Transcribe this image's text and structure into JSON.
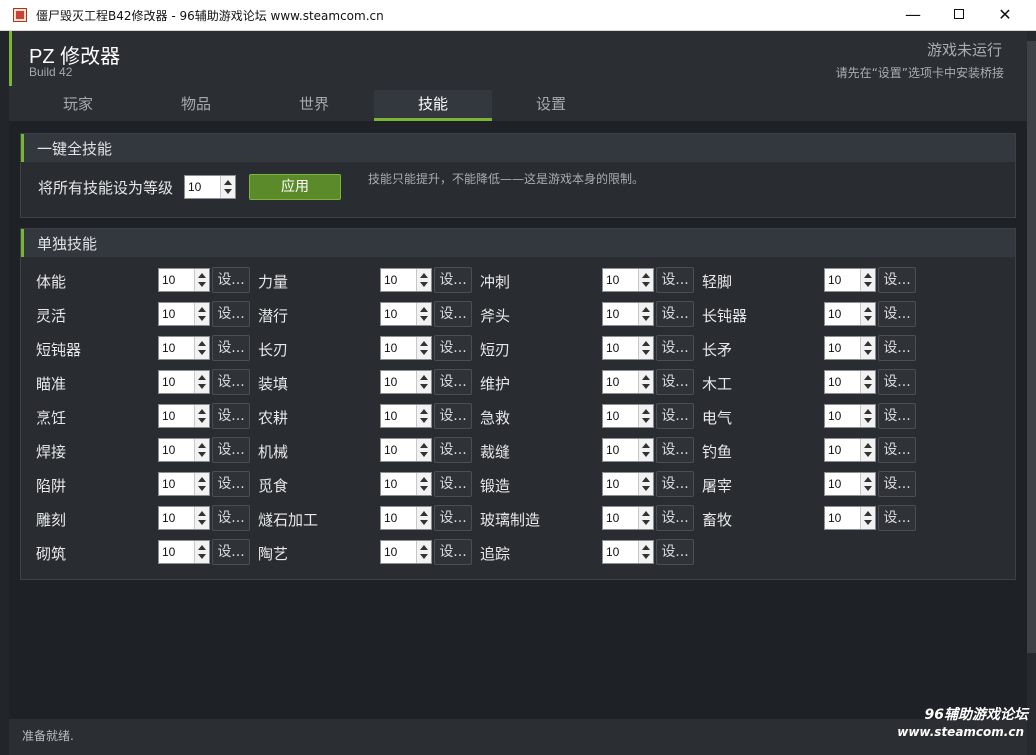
{
  "window": {
    "title": "僵尸毁灭工程B42修改器 - 96辅助游戏论坛 www.steamcom.cn",
    "minimize": "—",
    "close": "✕"
  },
  "header": {
    "app_title": "PZ 修改器",
    "build": "Build 42",
    "status_main": "游戏未运行",
    "status_sub": "请先在“设置”选项卡中安装桥接"
  },
  "tabs": [
    {
      "label": "玩家"
    },
    {
      "label": "物品"
    },
    {
      "label": "世界"
    },
    {
      "label": "技能"
    },
    {
      "label": "设置"
    }
  ],
  "active_tab": "技能",
  "all_skills": {
    "title": "一键全技能",
    "label": "将所有技能设为等级",
    "value": "10",
    "apply_label": "应用",
    "hint": "技能只能提升，不能降低——这是游戏本身的限制。"
  },
  "single_skills": {
    "title": "单独技能",
    "set_label": "设...",
    "items": [
      {
        "label": "体能",
        "value": "10"
      },
      {
        "label": "力量",
        "value": "10"
      },
      {
        "label": "冲刺",
        "value": "10"
      },
      {
        "label": "轻脚",
        "value": "10"
      },
      {
        "label": "灵活",
        "value": "10"
      },
      {
        "label": "潜行",
        "value": "10"
      },
      {
        "label": "斧头",
        "value": "10"
      },
      {
        "label": "长钝器",
        "value": "10"
      },
      {
        "label": "短钝器",
        "value": "10"
      },
      {
        "label": "长刃",
        "value": "10"
      },
      {
        "label": "短刃",
        "value": "10"
      },
      {
        "label": "长矛",
        "value": "10"
      },
      {
        "label": "瞄准",
        "value": "10"
      },
      {
        "label": "装填",
        "value": "10"
      },
      {
        "label": "维护",
        "value": "10"
      },
      {
        "label": "木工",
        "value": "10"
      },
      {
        "label": "烹饪",
        "value": "10"
      },
      {
        "label": "农耕",
        "value": "10"
      },
      {
        "label": "急救",
        "value": "10"
      },
      {
        "label": "电气",
        "value": "10"
      },
      {
        "label": "焊接",
        "value": "10"
      },
      {
        "label": "机械",
        "value": "10"
      },
      {
        "label": "裁缝",
        "value": "10"
      },
      {
        "label": "钓鱼",
        "value": "10"
      },
      {
        "label": "陷阱",
        "value": "10"
      },
      {
        "label": "觅食",
        "value": "10"
      },
      {
        "label": "锻造",
        "value": "10"
      },
      {
        "label": "屠宰",
        "value": "10"
      },
      {
        "label": "雕刻",
        "value": "10"
      },
      {
        "label": "燧石加工",
        "value": "10"
      },
      {
        "label": "玻璃制造",
        "value": "10"
      },
      {
        "label": "畜牧",
        "value": "10"
      },
      {
        "label": "砌筑",
        "value": "10"
      },
      {
        "label": "陶艺",
        "value": "10"
      },
      {
        "label": "追踪",
        "value": "10"
      }
    ]
  },
  "statusbar": {
    "text": "准备就绪."
  },
  "watermark": {
    "line1": "96辅助游戏论坛",
    "line2": "www.steamcom.cn"
  },
  "colors": {
    "accent": "#7ab536",
    "background": "#1e2125",
    "panel": "#292d31"
  }
}
